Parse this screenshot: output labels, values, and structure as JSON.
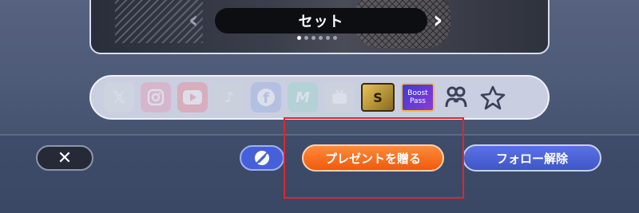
{
  "card": {
    "title": "セット",
    "prev_arrow": "‹",
    "next_arrow": "›",
    "dots_count": 6,
    "active_dot": 0
  },
  "social": {
    "items": [
      {
        "name": "x",
        "label": "𝕏",
        "faded": true
      },
      {
        "name": "instagram",
        "label": "",
        "faded": true
      },
      {
        "name": "youtube",
        "label": "",
        "faded": true
      },
      {
        "name": "tiktok",
        "label": "♪",
        "faded": true
      },
      {
        "name": "facebook",
        "label": "f",
        "faded": true
      },
      {
        "name": "misskey",
        "label": "M",
        "faded": true
      },
      {
        "name": "tv",
        "label": "",
        "faded": true
      }
    ],
    "badge_s": "S",
    "badge_b": "Boost Pass",
    "link_icon": "link-icon",
    "star_icon": "star-icon"
  },
  "buttons": {
    "close": "✕",
    "present": "プレゼントを贈る",
    "unfollow": "フォロー解除"
  },
  "colors": {
    "present": "#f26a1b",
    "unfollow": "#4b62d6",
    "highlight": "#e0262c"
  }
}
